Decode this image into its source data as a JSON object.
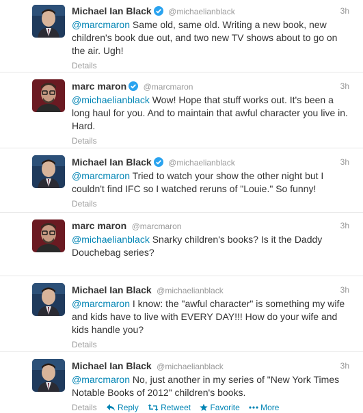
{
  "tweets": [
    {
      "fullname": "Michael Ian Black",
      "verified": true,
      "username": "@michaelianblack",
      "time": "3h",
      "mention": "@marcmaron",
      "text": " Same old, same old. Writing a new book, new children's book due out, and two new TV shows about to go on the air. Ugh!",
      "details": "Details",
      "avatar_icon": "avatar-michael-ian-black"
    },
    {
      "fullname": "marc maron",
      "verified": true,
      "username": "@marcmaron",
      "time": "3h",
      "mention": "@michaelianblack",
      "text": " Wow! Hope that stuff works out. It's been a long haul for you. And to maintain that awful character you live in. Hard.",
      "details": "Details",
      "avatar_icon": "avatar-marc-maron"
    },
    {
      "fullname": "Michael Ian Black",
      "verified": true,
      "username": "@michaelianblack",
      "time": "3h",
      "mention": "@marcmaron",
      "text": " Tried to watch your show the other night but I couldn't find IFC so I watched reruns of \"Louie.\" So funny!",
      "details": "Details",
      "avatar_icon": "avatar-michael-ian-black"
    },
    {
      "fullname": "marc maron",
      "verified": false,
      "username": "@marcmaron",
      "time": "3h",
      "mention": "@michaelianblack",
      "text": " Snarky children's books? Is it the Daddy Douchebag series?",
      "details": "Details",
      "avatar_icon": "avatar-marc-maron"
    },
    {
      "fullname": "Michael Ian Black",
      "verified": false,
      "username": "@michaelianblack",
      "time": "3h",
      "mention": "@marcmaron",
      "text": " I know: the \"awful character\" is something my wife and kids have to live with EVERY DAY!!! How do your wife and kids handle you?",
      "details": "Details",
      "avatar_icon": "avatar-michael-ian-black"
    },
    {
      "fullname": "Michael Ian Black",
      "verified": false,
      "username": "@michaelianblack",
      "time": "3h",
      "mention": "@marcmaron",
      "text": " No, just another in my series of \"New York Times Notable Books of 2012\" children's books.",
      "details": "Details",
      "avatar_icon": "avatar-michael-ian-black",
      "actions": [
        {
          "label": "Reply",
          "icon": "reply-icon"
        },
        {
          "label": "Retweet",
          "icon": "retweet-icon"
        },
        {
          "label": "Favorite",
          "icon": "star-icon"
        },
        {
          "label": "More",
          "icon": "more-icon"
        }
      ]
    }
  ],
  "colors": {
    "link": "#0084b4",
    "muted": "#999999",
    "text": "#333333",
    "verified": "#2aa3ef",
    "divider": "#e6e6e6"
  }
}
